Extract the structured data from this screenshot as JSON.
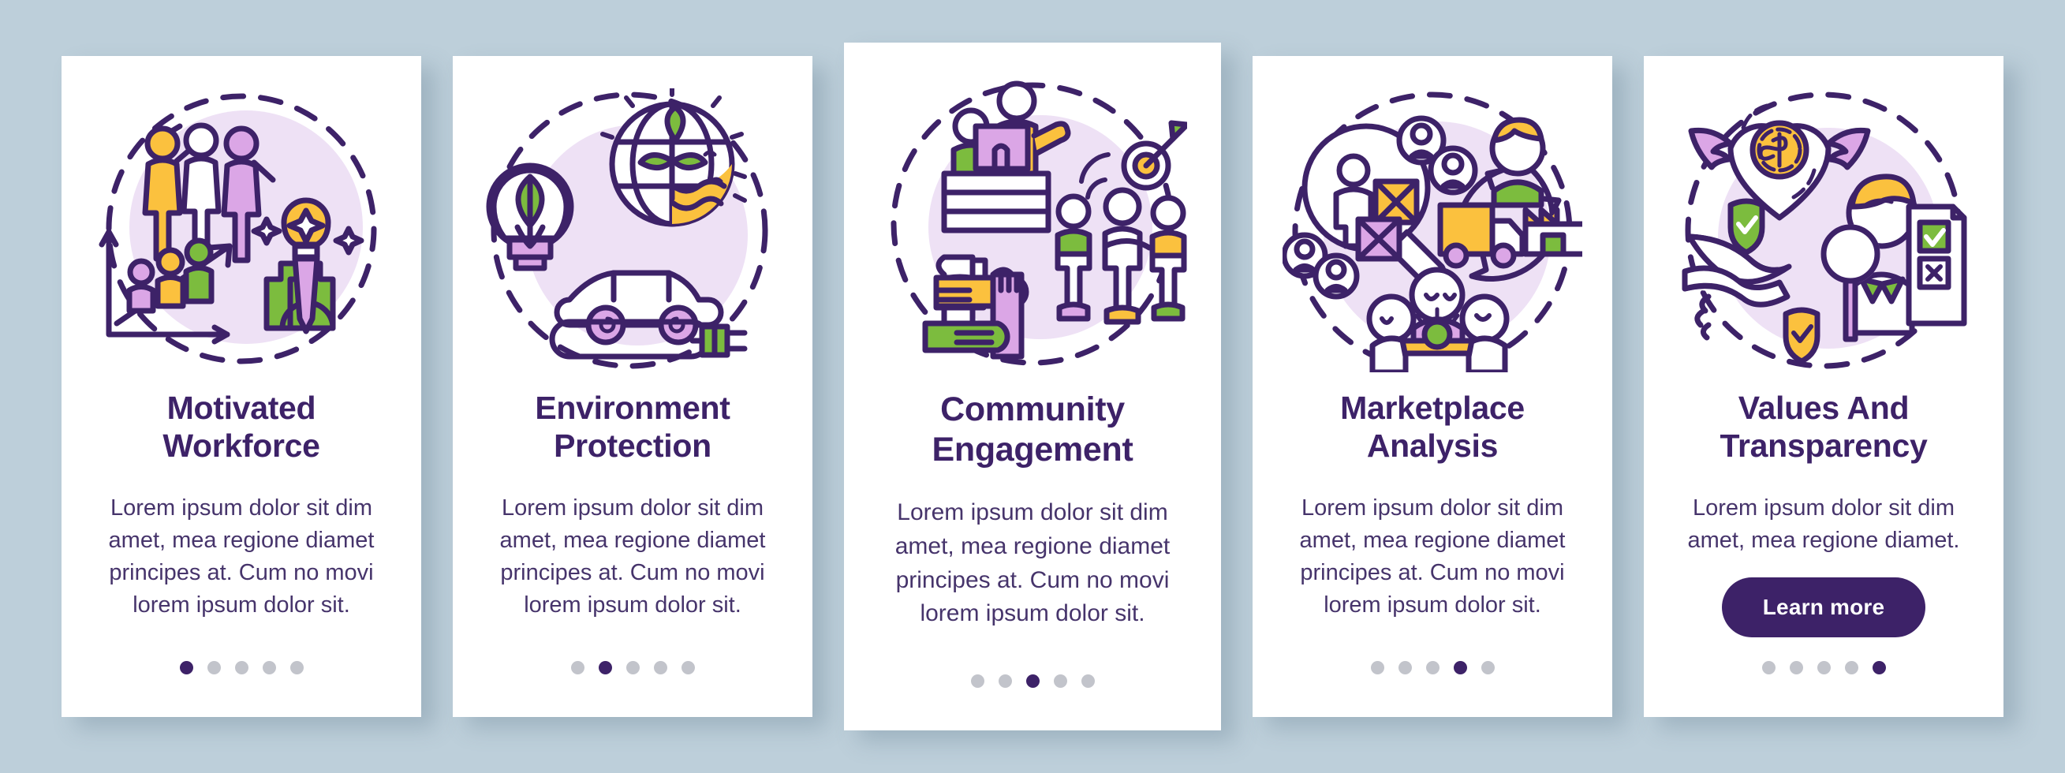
{
  "background_color": "#bdcfda",
  "theme": {
    "primary_purple": "#3d2268",
    "body_text": "#46346b",
    "dot_inactive": "#c2c4cb",
    "card_background": "#ffffff",
    "accent_yellow": "#fbc13e",
    "accent_green": "#7cbc3e",
    "accent_lilac": "#dba6e6",
    "blob_lavender": "#eee1f5"
  },
  "cards": [
    {
      "illustration": "motivated-workforce-illustration",
      "title": "Motivated\nWorkforce",
      "body": "Lorem ipsum dolor sit dim amet, mea regione diamet principes at. Cum no movi lorem ipsum dolor sit.",
      "dots": 5,
      "active_dot": 1,
      "button": null
    },
    {
      "illustration": "environment-protection-illustration",
      "title": "Environment\nProtection",
      "body": "Lorem ipsum dolor sit dim amet, mea regione diamet principes at. Cum no movi lorem ipsum dolor sit.",
      "dots": 5,
      "active_dot": 2,
      "button": null
    },
    {
      "illustration": "community-engagement-illustration",
      "title": "Community\nEngagement",
      "body": "Lorem ipsum dolor sit dim amet, mea regione diamet principes at. Cum no movi lorem ipsum dolor sit.",
      "dots": 5,
      "active_dot": 3,
      "button": null
    },
    {
      "illustration": "marketplace-analysis-illustration",
      "title": "Marketplace\nAnalysis",
      "body": "Lorem ipsum dolor sit dim amet, mea regione diamet principes at. Cum no movi lorem ipsum dolor sit.",
      "dots": 5,
      "active_dot": 4,
      "button": null
    },
    {
      "illustration": "values-and-transparency-illustration",
      "title": "Values And\nTransparency",
      "body": "Lorem ipsum dolor sit dim amet, mea regione diamet.",
      "dots": 5,
      "active_dot": 5,
      "button": "Learn more"
    }
  ]
}
